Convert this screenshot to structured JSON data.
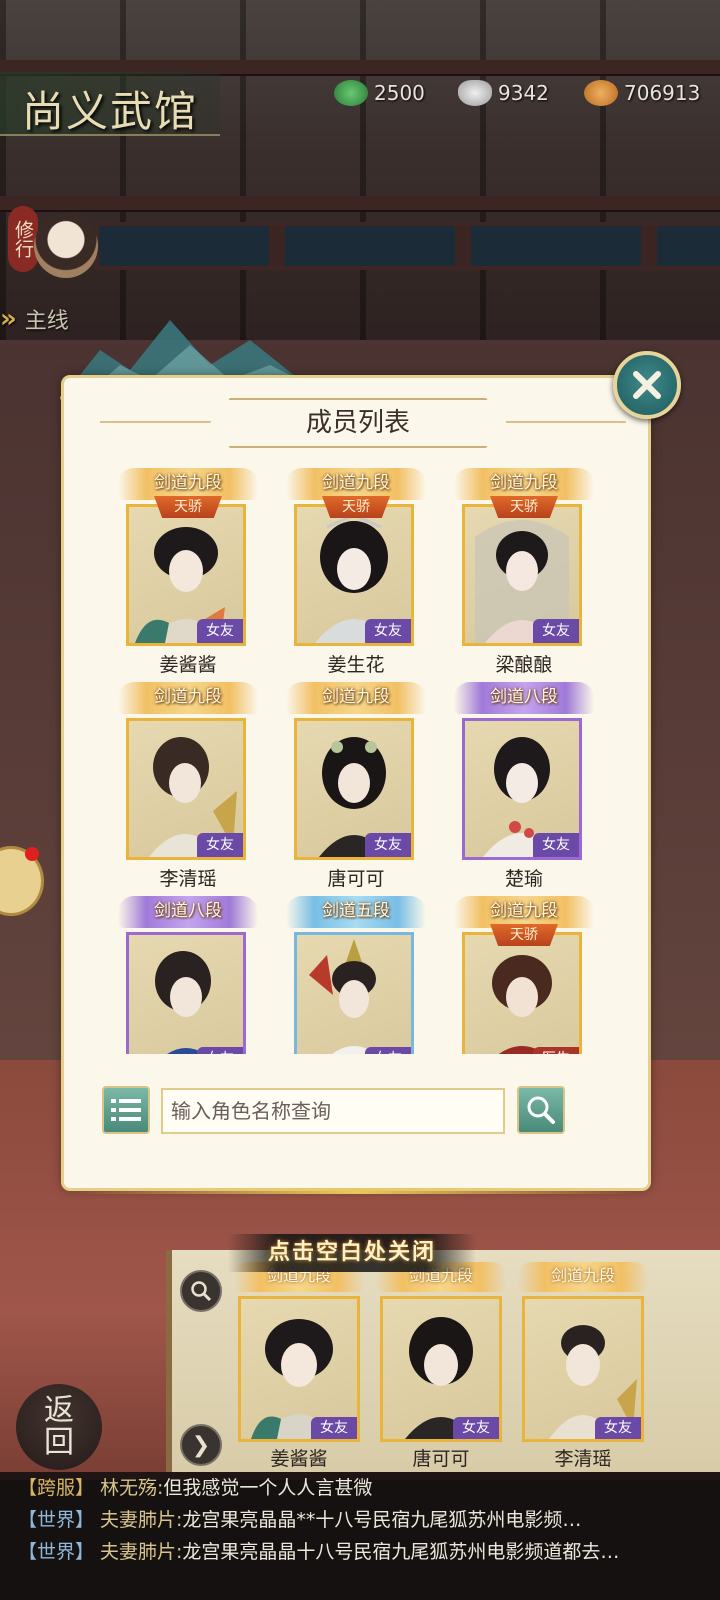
{
  "hall": {
    "title": "尚义武馆",
    "resources": [
      {
        "icon": "jade-coin-icon",
        "value": "2500"
      },
      {
        "icon": "silver-ingot-icon",
        "value": "9342"
      },
      {
        "icon": "copper-coin-icon",
        "value": "706913"
      }
    ]
  },
  "sidebar": {
    "training_label": "修行",
    "mainline_label": "主线"
  },
  "modal": {
    "title": "成员列表",
    "members": [
      {
        "rank": "剑道九段",
        "rank_tier": "gold",
        "badge": "天骄",
        "tag": "女友",
        "name": "姜酱酱"
      },
      {
        "rank": "剑道九段",
        "rank_tier": "gold",
        "badge": "天骄",
        "tag": "女友",
        "name": "姜生花"
      },
      {
        "rank": "剑道九段",
        "rank_tier": "gold",
        "badge": "天骄",
        "tag": "女友",
        "name": "梁酿酿"
      },
      {
        "rank": "剑道九段",
        "rank_tier": "gold",
        "badge": "",
        "tag": "女友",
        "name": "李清瑶"
      },
      {
        "rank": "剑道九段",
        "rank_tier": "gold",
        "badge": "",
        "tag": "女友",
        "name": "唐可可"
      },
      {
        "rank": "剑道八段",
        "rank_tier": "purple",
        "badge": "",
        "tag": "女友",
        "name": "楚瑜"
      },
      {
        "rank": "剑道八段",
        "rank_tier": "purple",
        "badge": "",
        "tag": "女友",
        "name": ""
      },
      {
        "rank": "剑道五段",
        "rank_tier": "blue",
        "badge": "",
        "tag": "女友",
        "name": ""
      },
      {
        "rank": "剑道九段",
        "rank_tier": "gold",
        "badge": "天骄",
        "tag": "医生",
        "name": ""
      }
    ],
    "search_placeholder": "输入角色名称查询",
    "close_hint": "点击空白处关闭"
  },
  "roster": [
    {
      "rank": "剑道九段",
      "tag": "女友",
      "name": "姜酱酱"
    },
    {
      "rank": "剑道九段",
      "tag": "女友",
      "name": "唐可可"
    },
    {
      "rank": "剑道九段",
      "tag": "女友",
      "name": "李清瑶"
    }
  ],
  "back_label_top": "返",
  "back_label_bottom": "回",
  "chat": [
    {
      "channel": "【跨服】",
      "sender": "林无殇:",
      "message": "但我感觉一个人人言甚微"
    },
    {
      "channel": "【世界】",
      "sender": "夫妻肺片:",
      "message": "龙宫果亮晶晶**十八号民宿九尾狐苏州电影频…"
    },
    {
      "channel": "【世界】",
      "sender": "夫妻肺片:",
      "message": "龙宫果亮晶晶十八号民宿九尾狐苏州电影频道都去…"
    }
  ],
  "colors": {
    "accent_gold": "#e8b43c",
    "accent_purple": "#9a6ad0",
    "accent_blue": "#78b8e0",
    "teal_button": "#4a8a78"
  }
}
